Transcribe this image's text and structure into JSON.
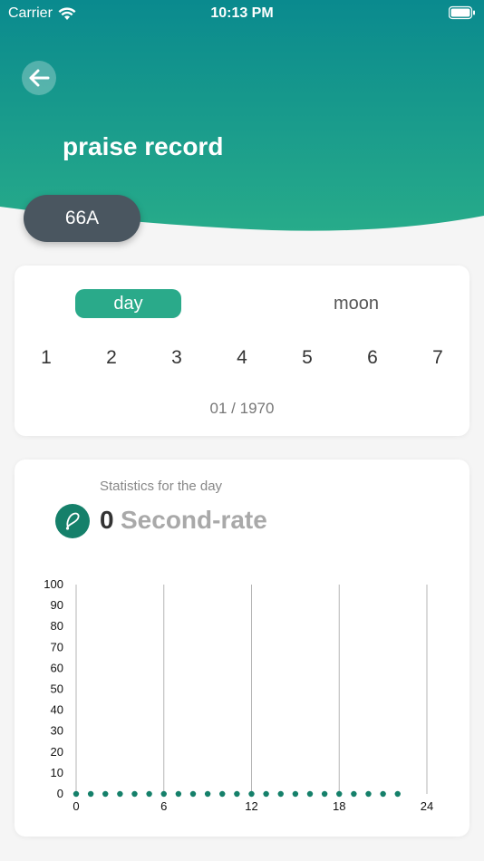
{
  "status_bar": {
    "carrier": "Carrier",
    "time": "10:13 PM"
  },
  "header": {
    "title": "praise record",
    "code_pill": "66A"
  },
  "date_card": {
    "tabs": [
      {
        "label": "day",
        "active": true
      },
      {
        "label": "moon",
        "active": false
      }
    ],
    "days": [
      "1",
      "2",
      "3",
      "4",
      "5",
      "6",
      "7"
    ],
    "month_label": "01 / 1970"
  },
  "stats_card": {
    "caption": "Statistics for the day",
    "count": "0",
    "unit": "Second-rate"
  },
  "colors": {
    "accent": "#2aaa8a",
    "header_top": "#0a8a8e",
    "header_bottom": "#27ab8a",
    "pill": "#4a5660",
    "dots": "#15806a"
  },
  "chart_data": {
    "type": "scatter",
    "x_ticks": [
      0,
      6,
      12,
      18,
      24
    ],
    "y_ticks": [
      0,
      10,
      20,
      30,
      40,
      50,
      60,
      70,
      80,
      90,
      100
    ],
    "xlim": [
      0,
      24
    ],
    "ylim": [
      0,
      100
    ],
    "grid": "vertical",
    "series": [
      {
        "x": [
          0,
          1,
          2,
          3,
          4,
          5,
          6,
          7,
          8,
          9,
          10,
          11,
          12,
          13,
          14,
          15,
          16,
          17,
          18,
          19,
          20,
          21,
          22
        ],
        "y": [
          0,
          0,
          0,
          0,
          0,
          0,
          0,
          0,
          0,
          0,
          0,
          0,
          0,
          0,
          0,
          0,
          0,
          0,
          0,
          0,
          0,
          0,
          0
        ]
      }
    ]
  }
}
